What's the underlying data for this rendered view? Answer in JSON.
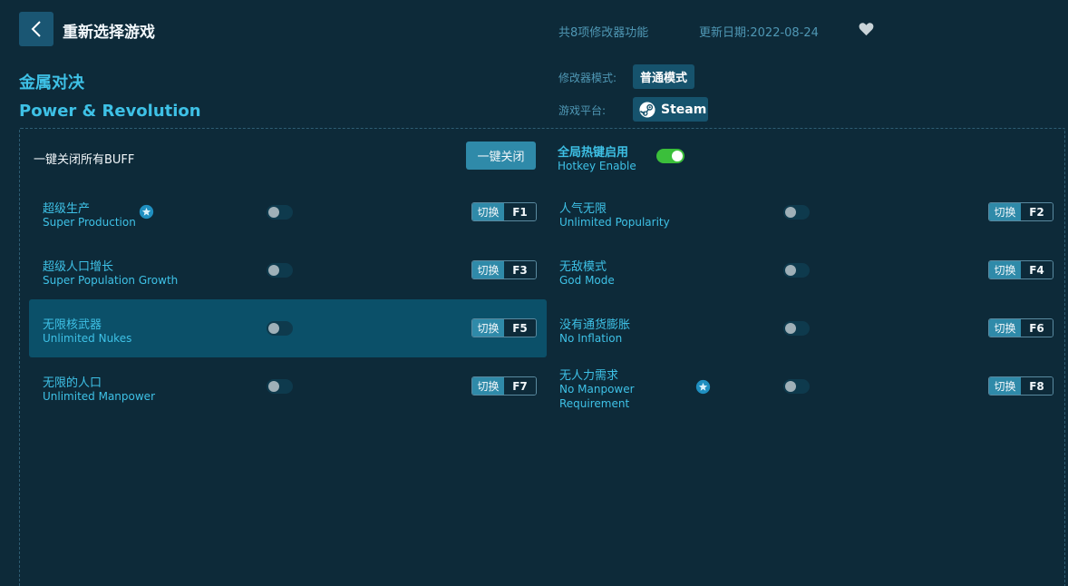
{
  "header": {
    "title": "重新选择游戏",
    "feature_count": "共8项修改器功能",
    "update_date": "更新日期:2022-08-24"
  },
  "game": {
    "name_cn": "金属对决",
    "name_en": "Power & Revolution"
  },
  "modifier": {
    "mode_label": "修改器模式:",
    "mode_value": "普通模式",
    "platform_label": "游戏平台:",
    "platform_value": "Steam"
  },
  "controls": {
    "all_buff_label": "一键关闭所有BUFF",
    "close_all_button": "一键关闭",
    "hotkey_label_cn": "全局热键启用",
    "hotkey_label_en": "Hotkey Enable",
    "hotkey_enabled": true
  },
  "cheats": [
    {
      "cn": "超级生产",
      "en": "Super Production",
      "action": "切换",
      "key": "F1",
      "starred": true,
      "enabled": false
    },
    {
      "cn": "人气无限",
      "en": "Unlimited Popularity",
      "action": "切换",
      "key": "F2",
      "starred": false,
      "enabled": false
    },
    {
      "cn": "超级人口增长",
      "en": "Super Population Growth",
      "action": "切换",
      "key": "F3",
      "starred": false,
      "enabled": false
    },
    {
      "cn": "无敌模式",
      "en": "God Mode",
      "action": "切换",
      "key": "F4",
      "starred": false,
      "enabled": false
    },
    {
      "cn": "无限核武器",
      "en": "Unlimited Nukes",
      "action": "切换",
      "key": "F5",
      "starred": false,
      "enabled": false
    },
    {
      "cn": "没有通货膨胀",
      "en": "No Inflation",
      "action": "切换",
      "key": "F6",
      "starred": false,
      "enabled": false
    },
    {
      "cn": "无限的人口",
      "en": "Unlimited Manpower",
      "action": "切换",
      "key": "F7",
      "starred": false,
      "enabled": false
    },
    {
      "cn": "无人力需求",
      "en": "No Manpower Requirement",
      "action": "切换",
      "key": "F8",
      "starred": true,
      "enabled": false
    }
  ],
  "icons": {
    "back": "chevron-left-icon",
    "favorite": "heart-icon",
    "platform": "steam-icon",
    "star": "star-icon"
  },
  "colors": {
    "background": "#0d2a39",
    "accent": "#3ec1e6",
    "toggle_on": "#3bbf3b",
    "button": "#2f8aa9",
    "highlight_row": "#0b5069"
  }
}
